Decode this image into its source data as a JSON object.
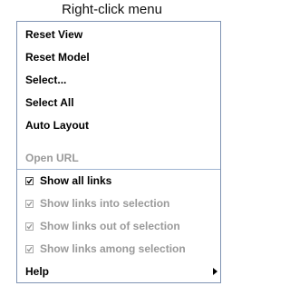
{
  "caption": "Right-click menu",
  "menu": {
    "reset_view": "Reset View",
    "reset_model": "Reset Model",
    "select": "Select...",
    "select_all": "Select All",
    "auto_layout": "Auto Layout",
    "open_url": "Open URL",
    "show_all_links": "Show all links",
    "show_links_into_selection": "Show links into selection",
    "show_links_out_of_selection": "Show links out of selection",
    "show_links_among_selection": "Show links among selection",
    "help": "Help"
  },
  "states": {
    "open_url_enabled": false,
    "show_all_links_checked": true,
    "show_links_into_selection_checked": true,
    "show_links_out_of_selection_checked": true,
    "show_links_among_selection_checked": true
  },
  "icons": {
    "checkbox": "checkbox-icon",
    "submenu_arrow": "submenu-arrow-icon"
  },
  "colors": {
    "menu_border": "#7f93b3",
    "separator": "#9fb4d2",
    "disabled_text": "#9a9a9a"
  }
}
